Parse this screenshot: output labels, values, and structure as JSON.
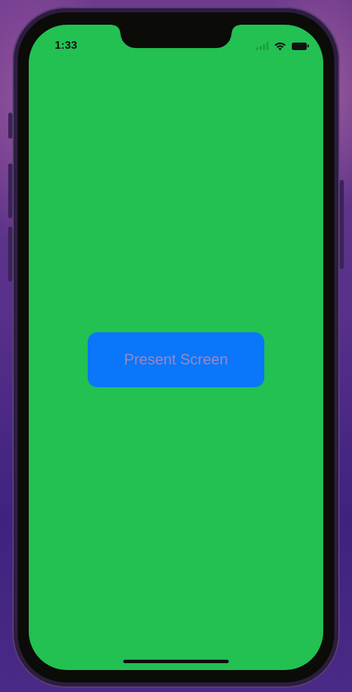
{
  "status_bar": {
    "time": "1:33",
    "icons": [
      "cellular-signal-icon",
      "wifi-icon",
      "battery-icon"
    ]
  },
  "main": {
    "background_color": "#22c152",
    "present_button": {
      "label": "Present Screen",
      "color": "#0a76fa"
    }
  },
  "device": {
    "frame_color": "#2c1d3e"
  }
}
